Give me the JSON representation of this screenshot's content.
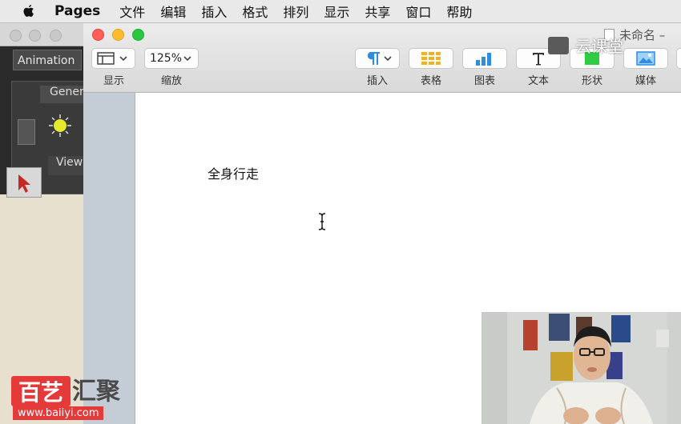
{
  "menubar": {
    "app_name": "Pages",
    "items": [
      "文件",
      "编辑",
      "插入",
      "格式",
      "排列",
      "显示",
      "共享",
      "窗口",
      "帮助"
    ]
  },
  "background_app": {
    "animation_tab": "Animation",
    "general_tab": "Gener",
    "view_tab": "View"
  },
  "window": {
    "doc_title": "未命名 –",
    "toolbar": {
      "view_label": "显示",
      "zoom_value": "125%",
      "zoom_label": "缩放",
      "insert_label": "插入",
      "table_label": "表格",
      "chart_label": "图表",
      "text_label": "文本",
      "shape_label": "形状",
      "media_label": "媒体"
    }
  },
  "document": {
    "body_text": "全身行走"
  },
  "watermarks": {
    "yunketang": "云课堂",
    "logo_red": "百艺",
    "logo_gray": "汇聚",
    "logo_url": "www.baiiyi.com"
  },
  "colors": {
    "traffic_close": "#ff5f57",
    "traffic_min": "#febc2e",
    "traffic_max": "#28c840",
    "icon_blue": "#2f8ce0",
    "icon_yellow": "#f3b21a",
    "icon_green": "#2ecc40"
  }
}
